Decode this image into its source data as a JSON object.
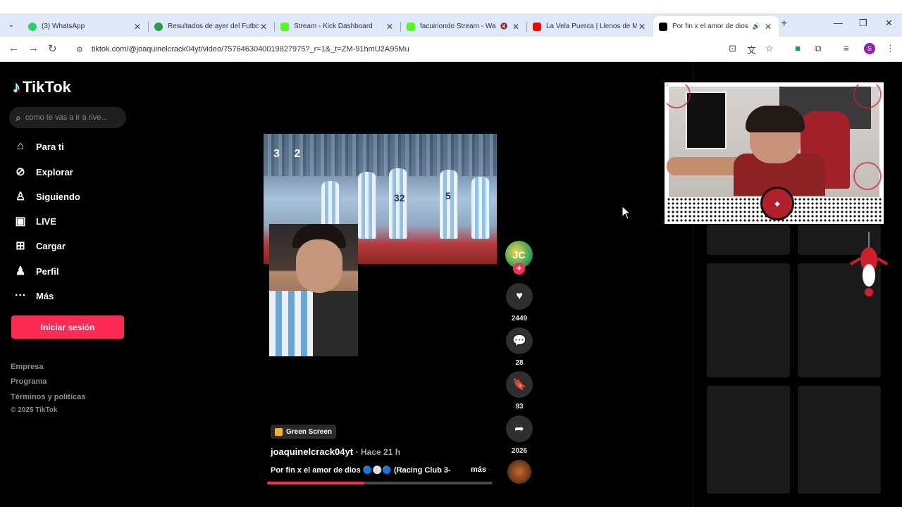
{
  "browser": {
    "tabs": [
      {
        "title": "(3) WhatsApp",
        "favicon_color": "#25d366",
        "active": false
      },
      {
        "title": "Resultados de ayer del Futbol",
        "favicon_color": "#1aa34a",
        "active": false
      },
      {
        "title": "Stream - Kick Dashboard",
        "favicon_color": "#53fc18",
        "active": false
      },
      {
        "title": "facuiriondo Stream - Wa",
        "favicon_color": "#53fc18",
        "active": false,
        "muted": true
      },
      {
        "title": "La Vela Puerca | Llenos de M",
        "favicon_color": "#ff0000",
        "active": false
      },
      {
        "title": "Por fin x el amor de dios",
        "favicon_color": "#000000",
        "active": true,
        "audio": true
      }
    ],
    "url": "tiktok.com/@joaquinelcrack04yt/video/7576463040019827975?_r=1&_t=ZM-91hmU2A95Mu",
    "profile_initial": "S"
  },
  "sidebar": {
    "logo": "TikTok",
    "search_placeholder": "como te vas a ir a rive...",
    "nav": [
      {
        "label": "Para ti",
        "icon": "home-icon"
      },
      {
        "label": "Explorar",
        "icon": "compass-icon"
      },
      {
        "label": "Siguiendo",
        "icon": "following-icon"
      },
      {
        "label": "LIVE",
        "icon": "live-tv-icon"
      },
      {
        "label": "Cargar",
        "icon": "upload-icon"
      },
      {
        "label": "Perfil",
        "icon": "profile-icon"
      },
      {
        "label": "Más",
        "icon": "more-icon"
      }
    ],
    "login_label": "Iniciar sesión",
    "footer": [
      "Empresa",
      "Programa",
      "Términos y políticas"
    ],
    "copyright": "© 2025 TikTok"
  },
  "video": {
    "score_left": "3",
    "score_right": "2",
    "shirt_numbers": [
      "32",
      "5"
    ],
    "effect_badge": "Green Screen",
    "author": "joaquinelcrack04yt",
    "time": "· Hace 21 h",
    "description": "Por fin x el amor de dios 🔵⚪🔵 (Racing Club 3-",
    "more_label": "más",
    "progress_fraction": 0.43
  },
  "actions": {
    "avatar_initials": "JC",
    "likes": "2449",
    "comments": "28",
    "saves": "93",
    "shares": "2026"
  },
  "colors": {
    "accent": "#fe2c55",
    "background": "#000000"
  }
}
